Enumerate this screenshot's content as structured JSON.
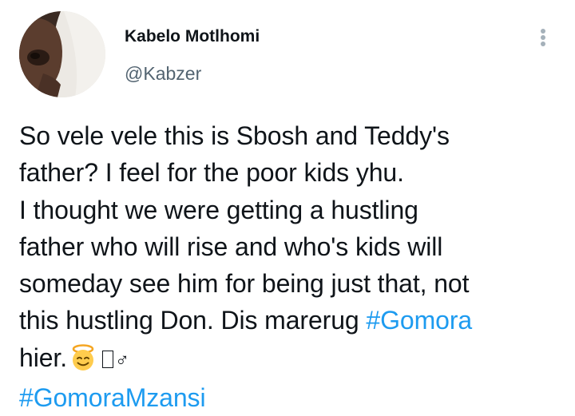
{
  "tweet": {
    "author": {
      "name": "Kabelo Motlhomi",
      "handle": "@Kabzer"
    },
    "body": {
      "line1": "So vele vele this is Sbosh and Teddy's",
      "line2": "father? I feel for the poor kids yhu.",
      "line3": "I thought we were getting a hustling",
      "line4": "father who will rise and who's kids will",
      "line5": "someday see him for being just that, not",
      "line6_text": "this hustling Don. Dis marerug ",
      "line6_hashtag": "#Gomora",
      "line7_text": "hier.",
      "line7_male_sign": "♂",
      "line8_hashtag": "#GomoraMzansi"
    },
    "icons": {
      "more": "more-options-icon",
      "emoji": "face-with-halo-emoji",
      "missing_glyph": "missing-glyph-box"
    },
    "colors": {
      "text": "#0f1419",
      "secondary": "#536471",
      "link": "#1d9bf0"
    }
  }
}
